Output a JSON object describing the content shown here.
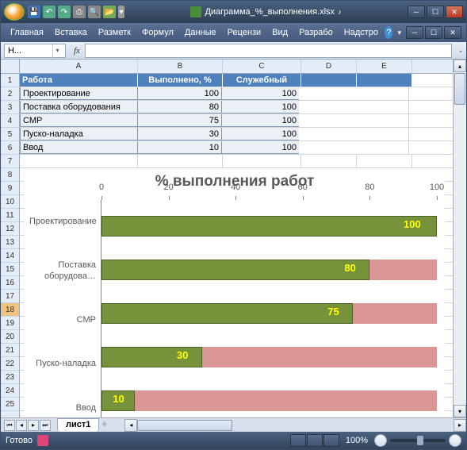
{
  "titlebar": {
    "filename": "Диаграмма_%_выполнения.xlsx"
  },
  "ribbon": {
    "tabs": [
      "Главная",
      "Вставка",
      "Разметк",
      "Формул",
      "Данные",
      "Рецензи",
      "Вид",
      "Разрабо",
      "Надстро"
    ]
  },
  "formula_bar": {
    "namebox": "Н...",
    "fx_label": "fx"
  },
  "columns": [
    "A",
    "B",
    "C",
    "D",
    "E"
  ],
  "rows": [
    "1",
    "2",
    "3",
    "4",
    "5",
    "6",
    "7",
    "8",
    "9",
    "10",
    "11",
    "12",
    "13",
    "14",
    "15",
    "16",
    "17",
    "18",
    "19",
    "20",
    "21",
    "22",
    "23",
    "24",
    "25"
  ],
  "selected_row": "18",
  "table": {
    "headers": {
      "A": "Работа",
      "B": "Выполнено, %",
      "C": "Служебный"
    },
    "data": [
      {
        "A": "Проектирование",
        "B": "100",
        "C": "100"
      },
      {
        "A": "Поставка оборудования",
        "B": "80",
        "C": "100"
      },
      {
        "A": "СМР",
        "B": "75",
        "C": "100"
      },
      {
        "A": "Пуско-наладка",
        "B": "30",
        "C": "100"
      },
      {
        "A": "Ввод",
        "B": "10",
        "C": "100"
      }
    ]
  },
  "chart_data": {
    "type": "bar",
    "title": "% выполнения работ",
    "xlim": [
      0,
      100
    ],
    "xticks": [
      0,
      20,
      40,
      60,
      80,
      100
    ],
    "categories": [
      "Проектирование",
      "Поставка оборудова…",
      "СМР",
      "Пуско-наладка",
      "Ввод"
    ],
    "series": [
      {
        "name": "Служебный",
        "values": [
          100,
          100,
          100,
          100,
          100
        ],
        "color": "#da9694"
      },
      {
        "name": "Выполнено, %",
        "values": [
          100,
          80,
          75,
          30,
          10
        ],
        "color": "#76933c"
      }
    ],
    "data_labels": [
      "100",
      "80",
      "75",
      "30",
      "10"
    ]
  },
  "sheet_tabs": {
    "active": "лист1"
  },
  "statusbar": {
    "ready": "Готово",
    "zoom": "100%"
  }
}
